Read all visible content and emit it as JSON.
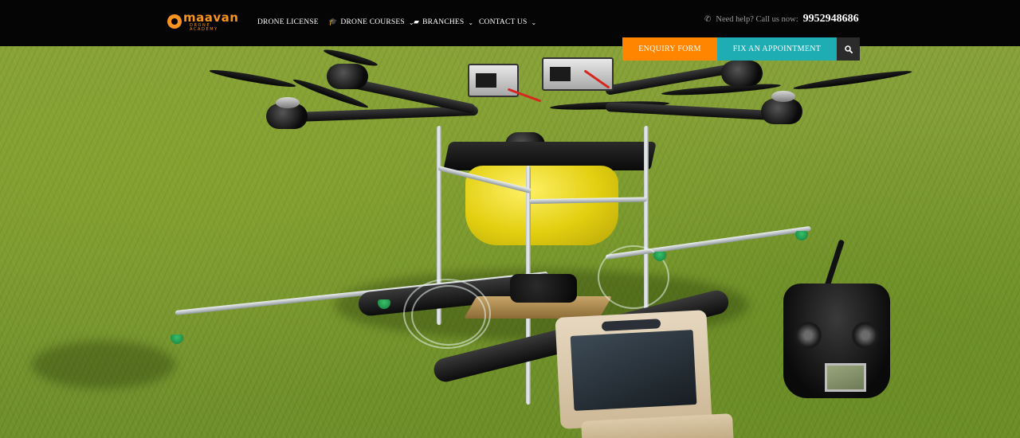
{
  "brand": {
    "logo_word": "maavan",
    "logo_sub": "DRONE ACADEMY",
    "accent": "#f7931e"
  },
  "nav": {
    "items": [
      {
        "label": "DRONE LICENSE",
        "icon": "",
        "has_dropdown": false
      },
      {
        "label": "DRONE COURSES",
        "icon": "graduation-cap-icon",
        "has_dropdown": true
      },
      {
        "label": "BRANCHES",
        "icon": "map-icon",
        "has_dropdown": true
      },
      {
        "label": "CONTACT US",
        "icon": "",
        "has_dropdown": true
      }
    ]
  },
  "help": {
    "text": "Need help? Call us now:",
    "phone": "9952948686",
    "icon": "phone-icon"
  },
  "actions": {
    "enquiry_label": "ENQUIRY FORM",
    "enquiry_color": "#ff8500",
    "appointment_label": "FIX AN APPOINTMENT",
    "appointment_color": "#1dadb3",
    "search_icon": "search-icon",
    "search_color": "#2b2b2b"
  },
  "hero": {
    "image": "agricultural-spraying-drone-on-grass-with-remote-and-monitor"
  }
}
